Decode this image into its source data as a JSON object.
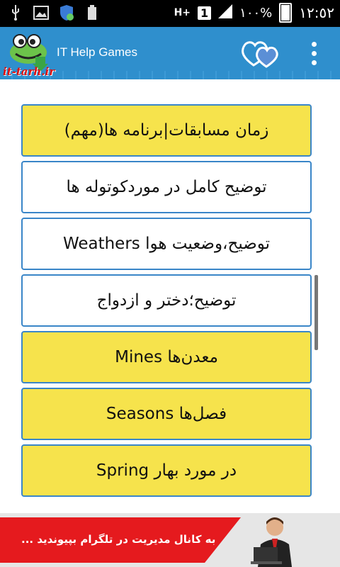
{
  "status_bar": {
    "network_badge": "H+",
    "sim_number": "1",
    "battery_percent": "١٠٠%",
    "time": "١٢:٥٢",
    "left_icons": [
      "usb-icon",
      "image-icon",
      "shield-icon",
      "battery-100-icon"
    ]
  },
  "app_bar": {
    "logo_text": "it-tarh.ir",
    "title": "IT Help Games",
    "accent_color": "#2f8fcd"
  },
  "list_items": [
    {
      "label": "زمان مسابقات|برنامه ها(مهم)",
      "style": "yellow"
    },
    {
      "label": "توضیح کامل در موردکوتوله ها",
      "style": "white"
    },
    {
      "label": "توضیح،وضعیت هوا Weathers",
      "style": "white"
    },
    {
      "label": "توضیح؛دختر و ازدواج",
      "style": "white"
    },
    {
      "label": "معدن‌ها Mines",
      "style": "yellow"
    },
    {
      "label": "فصل‌ها Seasons",
      "style": "yellow"
    },
    {
      "label": "در مورد بهار Spring",
      "style": "yellow"
    }
  ],
  "banner": {
    "text": "به کانال مدیریت در تلگرام بپیوندید ..."
  }
}
